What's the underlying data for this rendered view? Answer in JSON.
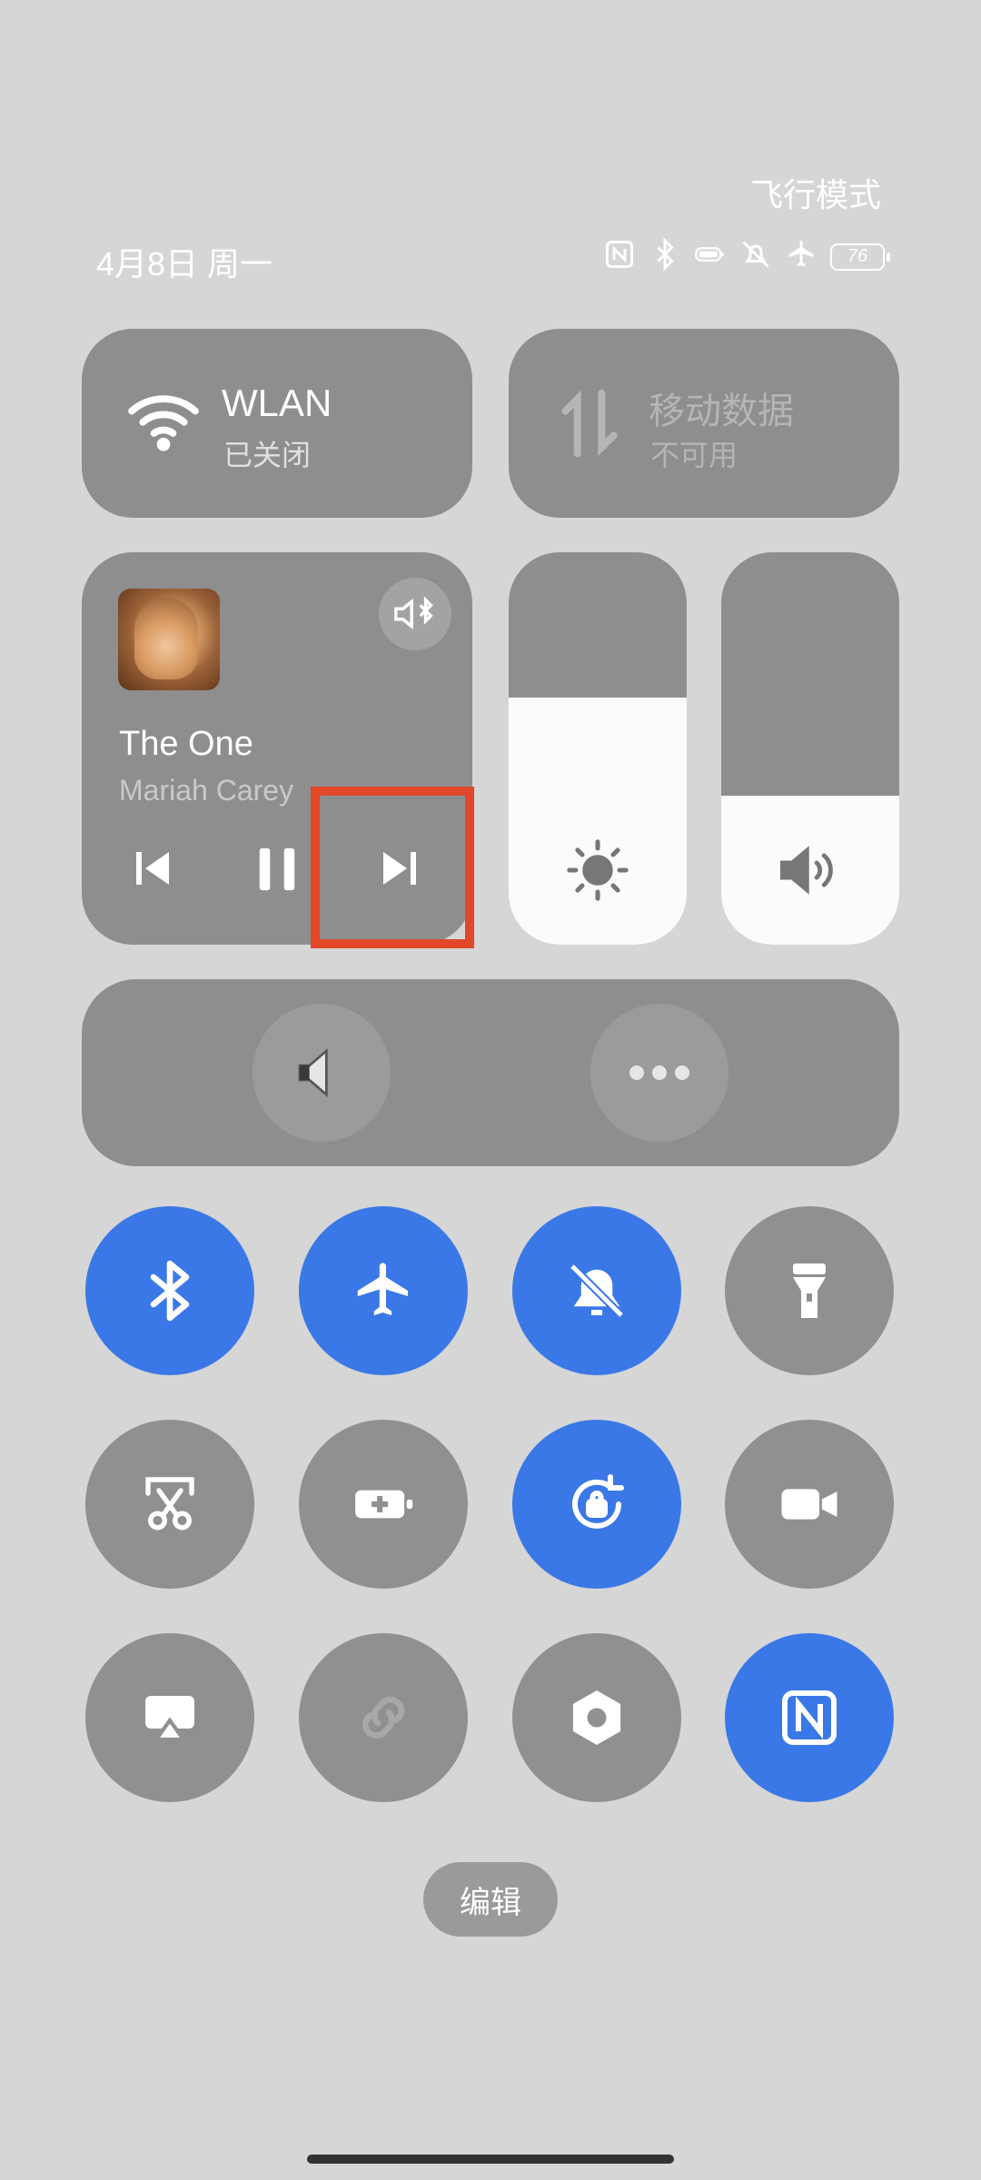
{
  "status_bar": {
    "top_right_label": "飞行模式",
    "date": "4月8日 周一",
    "battery": "76",
    "icons": [
      "nfc-icon",
      "bluetooth-icon",
      "battery-saver-icon",
      "mute-icon",
      "airplane-icon",
      "battery-icon"
    ]
  },
  "tiles": {
    "wlan": {
      "title": "WLAN",
      "subtitle": "已关闭"
    },
    "mobile": {
      "title": "移动数据",
      "subtitle": "不可用"
    }
  },
  "media": {
    "track_title": "The One",
    "artist": "Mariah Carey",
    "output_icon": "bluetooth-audio-icon",
    "controls": [
      "previous-icon",
      "pause-icon",
      "next-icon"
    ],
    "highlight": "next-button"
  },
  "sliders": {
    "brightness_level": 0.63,
    "volume_level": 0.38
  },
  "sound_row": {
    "left_icon": "speaker-icon",
    "right_icon": "more-icon"
  },
  "toggles": [
    {
      "name": "bluetooth",
      "icon": "bluetooth-icon",
      "on": true
    },
    {
      "name": "airplane-mode",
      "icon": "airplane-icon",
      "on": true
    },
    {
      "name": "silent-mode",
      "icon": "bell-off-icon",
      "on": true
    },
    {
      "name": "flashlight",
      "icon": "flashlight-icon",
      "on": false
    },
    {
      "name": "screenshot",
      "icon": "scissors-icon",
      "on": false
    },
    {
      "name": "battery-saver",
      "icon": "battery-plus-icon",
      "on": false
    },
    {
      "name": "rotation-lock",
      "icon": "rotation-lock-icon",
      "on": true
    },
    {
      "name": "screen-record",
      "icon": "video-camera-icon",
      "on": false
    },
    {
      "name": "screen-cast",
      "icon": "cast-icon",
      "on": false
    },
    {
      "name": "link",
      "icon": "link-icon",
      "on": false
    },
    {
      "name": "settings",
      "icon": "hexagon-icon",
      "on": false
    },
    {
      "name": "nfc",
      "icon": "nfc-icon",
      "on": true
    }
  ],
  "edit_label": "编辑",
  "colors": {
    "accent": "#3b78e7",
    "tile": "#8e8e8e",
    "background": "#d6d6d6",
    "highlight": "#e2472a"
  }
}
